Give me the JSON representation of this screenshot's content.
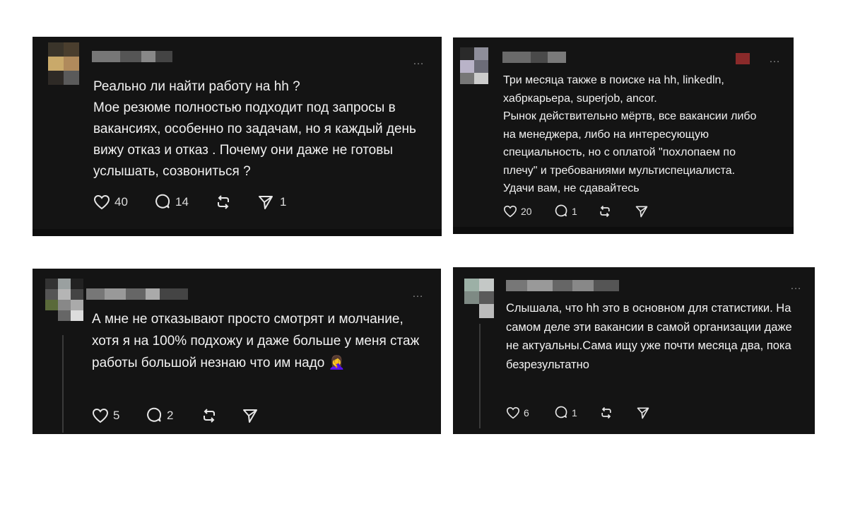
{
  "posts": [
    {
      "text": "Реально ли найти работу на hh ?\nМое резюме полностью подходит под запросы в вакансиях, особенно по задачам, но я каждый день вижу отказ и отказ . Почему они даже не готовы услышать, созвониться ?",
      "likes": "40",
      "replies": "14",
      "shares": "1"
    },
    {
      "text": "Три месяца также в поиске на hh, linkedln, хабркарьера, superjob, ancor.\nРынок действительно мёртв, все вакансии либо на менеджера, либо на интересующую специальность, но с оплатой \"похлопаем по плечу\" и требованиями мультиспециалиста.\nУдачи вам, не сдавайтесь",
      "likes": "20",
      "replies": "1",
      "shares": ""
    },
    {
      "text": "А мне не отказывают просто смотрят и молчание, хотя я на 100% подхожу и даже больше у меня стаж работы большой незнаю что им надо 🤦‍♀️",
      "likes": "5",
      "replies": "2",
      "shares": ""
    },
    {
      "text": "Слышала, что hh это в основном  для статистики. На самом деле эти вакансии в самой организации даже не актуальны.Сама ищу уже почти месяца два, пока безрезультатно",
      "likes": "6",
      "replies": "1",
      "shares": ""
    }
  ],
  "more_label": "…",
  "icons": [
    "heart-icon",
    "comment-icon",
    "repost-icon",
    "send-icon"
  ],
  "colors": {
    "card": "#141414",
    "text": "#f2f2f2",
    "muted": "#8a8a8a"
  }
}
